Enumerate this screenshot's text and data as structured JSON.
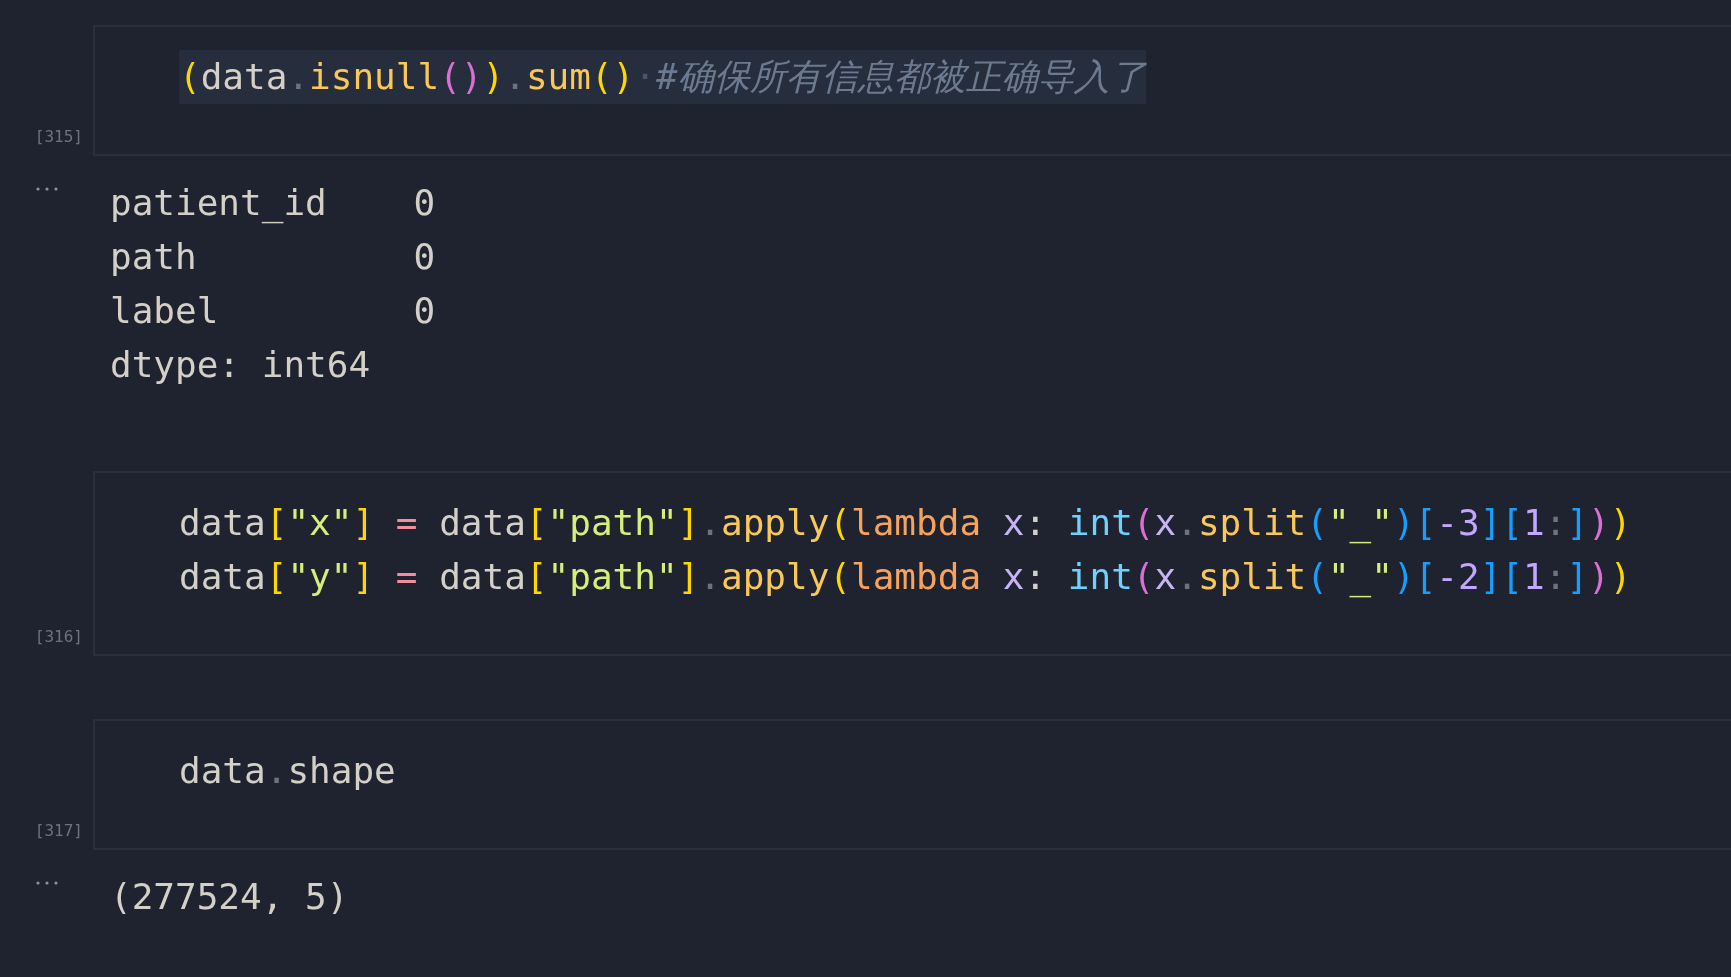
{
  "cells": [
    {
      "execution_count": "[315]",
      "code_lines": [
        {
          "highlighted": true,
          "tokens": [
            {
              "text": "(",
              "kind": "bracket1"
            },
            {
              "text": "data",
              "kind": "name"
            },
            {
              "text": ".",
              "kind": "dot"
            },
            {
              "text": "isnull",
              "kind": "method"
            },
            {
              "text": "(",
              "kind": "bracket2"
            },
            {
              "text": ")",
              "kind": "bracket2"
            },
            {
              "text": ")",
              "kind": "bracket1"
            },
            {
              "text": ".",
              "kind": "dot"
            },
            {
              "text": "sum",
              "kind": "method"
            },
            {
              "text": "()",
              "kind": "bracket1"
            },
            {
              "text": "·",
              "kind": "whitespace"
            },
            {
              "text": "#确保所有信息都被正确导入了",
              "kind": "comment"
            }
          ]
        }
      ],
      "output": {
        "lines": [
          "patient_id    0",
          "path          0",
          "label         0",
          "dtype: int64"
        ]
      }
    },
    {
      "execution_count": "[316]",
      "code_lines": [
        {
          "highlighted": false,
          "tokens": [
            {
              "text": "data",
              "kind": "name"
            },
            {
              "text": "[",
              "kind": "bracket1"
            },
            {
              "text": "\"x\"",
              "kind": "string"
            },
            {
              "text": "]",
              "kind": "bracket1"
            },
            {
              "text": " = ",
              "kind": "operator"
            },
            {
              "text": "data",
              "kind": "name"
            },
            {
              "text": "[",
              "kind": "bracket1"
            },
            {
              "text": "\"path\"",
              "kind": "string"
            },
            {
              "text": "]",
              "kind": "bracket1"
            },
            {
              "text": ".",
              "kind": "dot"
            },
            {
              "text": "apply",
              "kind": "method"
            },
            {
              "text": "(",
              "kind": "bracket1"
            },
            {
              "text": "lambda",
              "kind": "keyword"
            },
            {
              "text": " x",
              "kind": "param"
            },
            {
              "text": ": ",
              "kind": "name"
            },
            {
              "text": "int",
              "kind": "builtin"
            },
            {
              "text": "(",
              "kind": "bracket2"
            },
            {
              "text": "x",
              "kind": "param"
            },
            {
              "text": ".",
              "kind": "dot"
            },
            {
              "text": "split",
              "kind": "method"
            },
            {
              "text": "(",
              "kind": "bracket3"
            },
            {
              "text": "\"_\"",
              "kind": "string"
            },
            {
              "text": ")[",
              "kind": "bracket3"
            },
            {
              "text": "-3",
              "kind": "number"
            },
            {
              "text": "][",
              "kind": "bracket3"
            },
            {
              "text": "1",
              "kind": "number"
            },
            {
              "text": ":",
              "kind": "dot"
            },
            {
              "text": "]",
              "kind": "bracket3"
            },
            {
              "text": ")",
              "kind": "bracket2"
            },
            {
              "text": ")",
              "kind": "bracket1"
            }
          ]
        },
        {
          "highlighted": false,
          "tokens": [
            {
              "text": "data",
              "kind": "name"
            },
            {
              "text": "[",
              "kind": "bracket1"
            },
            {
              "text": "\"y\"",
              "kind": "string"
            },
            {
              "text": "]",
              "kind": "bracket1"
            },
            {
              "text": " = ",
              "kind": "operator"
            },
            {
              "text": "data",
              "kind": "name"
            },
            {
              "text": "[",
              "kind": "bracket1"
            },
            {
              "text": "\"path\"",
              "kind": "string"
            },
            {
              "text": "]",
              "kind": "bracket1"
            },
            {
              "text": ".",
              "kind": "dot"
            },
            {
              "text": "apply",
              "kind": "method"
            },
            {
              "text": "(",
              "kind": "bracket1"
            },
            {
              "text": "lambda",
              "kind": "keyword"
            },
            {
              "text": " x",
              "kind": "param"
            },
            {
              "text": ": ",
              "kind": "name"
            },
            {
              "text": "int",
              "kind": "builtin"
            },
            {
              "text": "(",
              "kind": "bracket2"
            },
            {
              "text": "x",
              "kind": "param"
            },
            {
              "text": ".",
              "kind": "dot"
            },
            {
              "text": "split",
              "kind": "method"
            },
            {
              "text": "(",
              "kind": "bracket3"
            },
            {
              "text": "\"_\"",
              "kind": "string"
            },
            {
              "text": ")[",
              "kind": "bracket3"
            },
            {
              "text": "-2",
              "kind": "number"
            },
            {
              "text": "][",
              "kind": "bracket3"
            },
            {
              "text": "1",
              "kind": "number"
            },
            {
              "text": ":",
              "kind": "dot"
            },
            {
              "text": "]",
              "kind": "bracket3"
            },
            {
              "text": ")",
              "kind": "bracket2"
            },
            {
              "text": ")",
              "kind": "bracket1"
            }
          ]
        }
      ]
    },
    {
      "execution_count": "[317]",
      "code_lines": [
        {
          "highlighted": false,
          "tokens": [
            {
              "text": "data",
              "kind": "name"
            },
            {
              "text": ".",
              "kind": "dot"
            },
            {
              "text": "shape",
              "kind": "name"
            }
          ]
        }
      ],
      "output": {
        "lines": [
          "(277524, 5)"
        ]
      }
    }
  ]
}
